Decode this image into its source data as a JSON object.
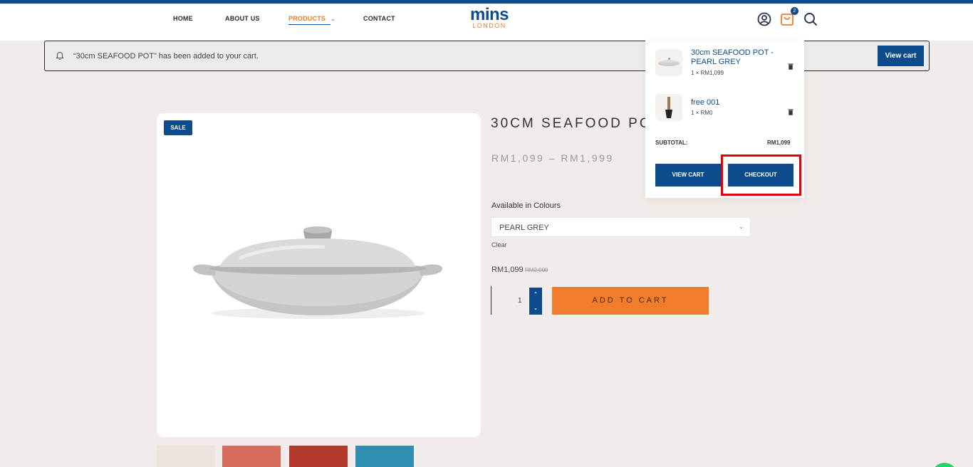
{
  "nav": {
    "home": "HOME",
    "about": "ABOUT US",
    "products": "PRODUCTS",
    "contact": "CONTACT"
  },
  "logo": {
    "main": "mins",
    "sub": "LONDON"
  },
  "header": {
    "cart_count": "2"
  },
  "notice": {
    "text": "“30cm SEAFOOD POT” has been added to your cart.",
    "button": "View cart"
  },
  "product": {
    "sale_badge": "SALE",
    "title": "30CM SEAFOOD PO",
    "price_range": "RM1,099 – RM1,999",
    "colour_label": "Available in Colours",
    "colour_selected": "PEARL GREY",
    "clear": "Clear",
    "price_now": "RM1,099",
    "price_old": "RM2,000",
    "quantity": "1",
    "add_to_cart": "ADD TO CART"
  },
  "minicart": {
    "items": [
      {
        "name": "30cm SEAFOOD POT - PEARL GREY",
        "qty": "1 × RM1,099"
      },
      {
        "name": "free 001",
        "qty": "1 × RM0"
      }
    ],
    "subtotal_label": "SUBTOTAL:",
    "subtotal_value": "RM1,099",
    "view_cart": "VIEW CART",
    "checkout": "CHECKOUT"
  },
  "colors": {
    "brand_blue": "#0e4b8a",
    "accent_orange": "#f07c2c",
    "highlight_red": "#e00010"
  }
}
